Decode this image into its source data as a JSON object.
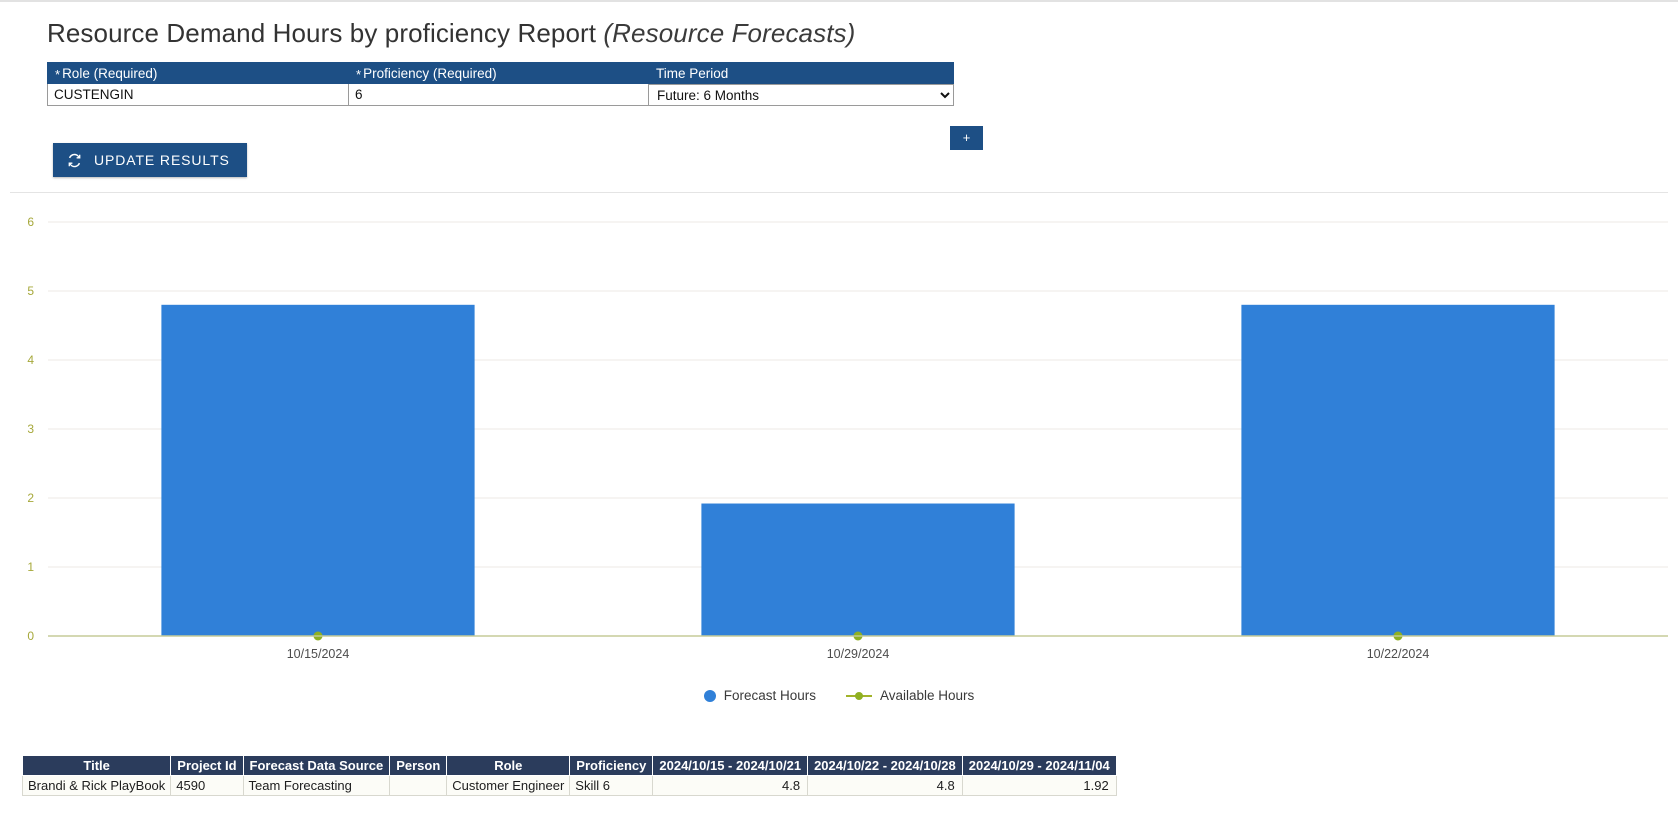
{
  "header": {
    "title_main": "Resource Demand Hours by proficiency Report",
    "title_sub": "(Resource Forecasts)"
  },
  "filters": {
    "add_button_label": "+",
    "items": [
      {
        "label": "Role (Required)",
        "required_marker": "*",
        "value": "CUSTENGIN",
        "placeholder": "",
        "type": "text"
      },
      {
        "label": "Proficiency (Required)",
        "required_marker": "*",
        "value": "6",
        "placeholder": "",
        "type": "text"
      },
      {
        "label": "Time Period",
        "required_marker": "",
        "value": "Future: 6 Months",
        "placeholder": "",
        "type": "select",
        "options": [
          "Future: 6 Months"
        ]
      }
    ]
  },
  "toolbar": {
    "update_label": "UPDATE RESULTS",
    "update_icon": "refresh-icon"
  },
  "colors": {
    "header_blue": "#1d4f85",
    "bar_blue": "#3080d8",
    "available_olive": "#a2b32a",
    "table_header": "#2b3c5c"
  },
  "chart_data": {
    "type": "bar",
    "title": "",
    "xlabel": "",
    "ylabel": "",
    "ylim": [
      0,
      6
    ],
    "yticks": [
      0,
      1,
      2,
      3,
      4,
      5,
      6
    ],
    "grid": true,
    "legend_position": "bottom",
    "categories": [
      "10/15/2024",
      "10/29/2024",
      "10/22/2024"
    ],
    "series": [
      {
        "name": "Forecast Hours",
        "type": "bar",
        "color": "#3080d8",
        "values": [
          4.8,
          1.92,
          4.8
        ]
      },
      {
        "name": "Available Hours",
        "type": "line",
        "color": "#a2b32a",
        "values": [
          0,
          0,
          0
        ]
      }
    ]
  },
  "table": {
    "columns": [
      "Title",
      "Project Id",
      "Forecast Data Source",
      "Person",
      "Role",
      "Proficiency",
      "2024/10/15 - 2024/10/21",
      "2024/10/22 - 2024/10/28",
      "2024/10/29 - 2024/11/04"
    ],
    "rows": [
      {
        "title": "Brandi & Rick PlayBook",
        "project_id": "4590",
        "forecast_data_source": "Team Forecasting",
        "person": "",
        "role": "Customer Engineer",
        "proficiency": "Skill 6",
        "w1": "4.8",
        "w2": "4.8",
        "w3": "1.92"
      }
    ]
  }
}
